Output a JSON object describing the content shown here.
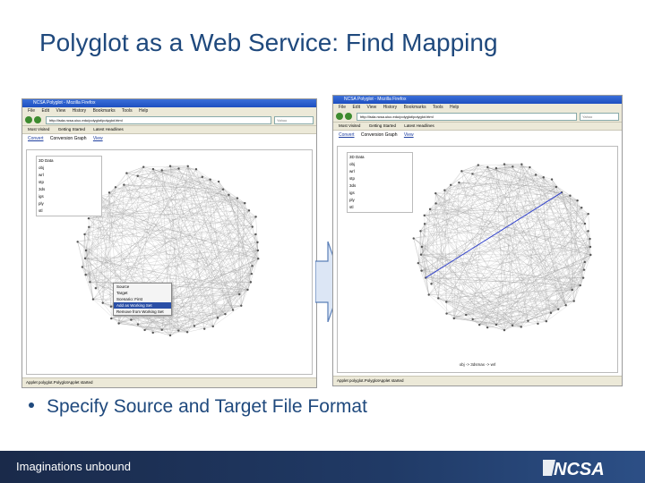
{
  "slide": {
    "title": "Polyglot as a Web Service: Find Mapping",
    "bullet": "Specify Source and Target File Format",
    "footer": "Imaginations unbound",
    "logo": "NCSA"
  },
  "left_window": {
    "title": "NCSA Polyglot - Mozilla Firefox",
    "menu": [
      "File",
      "Edit",
      "View",
      "History",
      "Bookmarks",
      "Tools",
      "Help"
    ],
    "url": "http://isda.ncsa.uiuc.edu/polyglot/polyglot.html",
    "search_placeholder": "Yahoo",
    "bookmarks": [
      "Most Visited",
      "Getting Started",
      "Latest Headlines"
    ],
    "tabs": [
      "Convert",
      "Conversion Graph",
      "View"
    ],
    "active_tab": "Conversion Graph",
    "tree": [
      "3D Data",
      "obj",
      "wrl",
      "stp",
      "3ds",
      "igs",
      "ply",
      "stl"
    ],
    "context_menu": [
      "Source",
      "Target",
      "Scenario: First",
      "Add as Working Set",
      "Remove from Working Set"
    ],
    "status": "Applet polyglot.PolyglotApplet started"
  },
  "right_window": {
    "title": "NCSA Polyglot - Mozilla Firefox",
    "menu": [
      "File",
      "Edit",
      "View",
      "History",
      "Bookmarks",
      "Tools",
      "Help"
    ],
    "url": "http://isda.ncsa.uiuc.edu/polyglot/polyglot.html",
    "search_placeholder": "Yahoo",
    "bookmarks": [
      "Most Visited",
      "Getting Started",
      "Latest Headlines"
    ],
    "tabs": [
      "Convert",
      "Conversion Graph",
      "View"
    ],
    "active_tab": "Conversion Graph",
    "tree": [
      "3D Data",
      "obj",
      "wrl",
      "stp",
      "3ds",
      "igs",
      "ply",
      "stl"
    ],
    "mapping_result": "obj -> 3dsmax -> wrl",
    "status": "Applet polyglot.PolyglotApplet started"
  },
  "colors": {
    "title_blue": "#1f497d",
    "footer_navy": "#1a2a4a",
    "path_blue": "#3344cc",
    "arrow_fill": "#dce6f5"
  },
  "icons": [
    "arrow-right-icon",
    "ncsa-logo-icon"
  ]
}
